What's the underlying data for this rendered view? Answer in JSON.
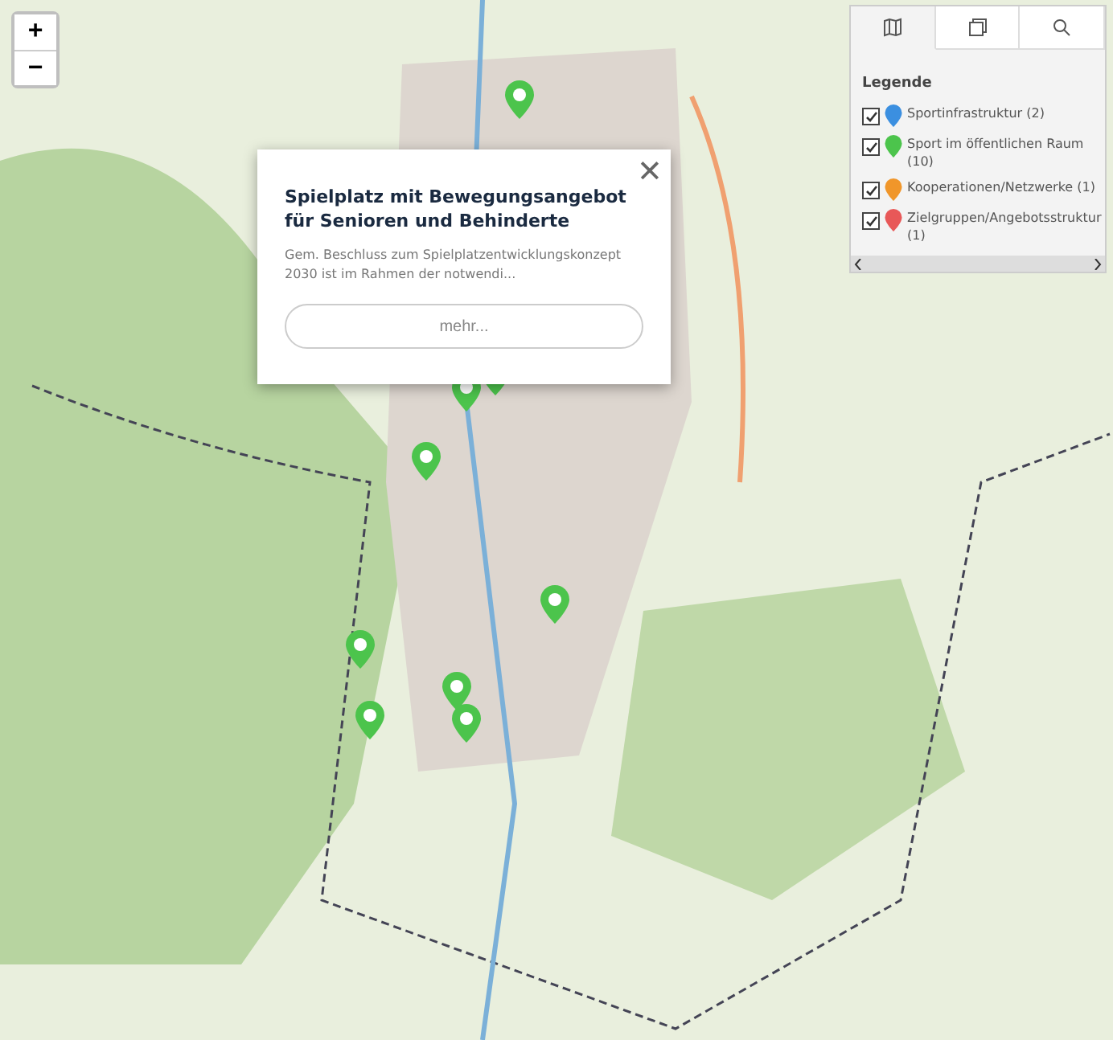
{
  "zoom_controls": {
    "zoom_in": "+",
    "zoom_out": "−"
  },
  "popup": {
    "close": "✕",
    "title": "Spielplatz mit Bewegungsangebot für Senioren und Behinderte",
    "description": "Gem. Beschluss zum Spielplatzentwicklungskonzept 2030 ist im Rahmen der notwendi...",
    "button": "mehr..."
  },
  "panel": {
    "tabs": [
      {
        "kind": "map",
        "selected": true
      },
      {
        "kind": "layers",
        "selected": false
      },
      {
        "kind": "search",
        "selected": false
      }
    ],
    "legend_title": "Legende",
    "items": [
      {
        "label": "Sportinfrastruktur (2)",
        "checked": true,
        "color": "#3b8fe0"
      },
      {
        "label": "Sport im öffentlichen Raum (10)",
        "checked": true,
        "color": "#4cc44c"
      },
      {
        "label": "Kooperationen/Netzwerke (1)",
        "checked": true,
        "color": "#f0962a"
      },
      {
        "label": "Zielgruppen/Angebotsstruktur (1)",
        "checked": true,
        "color": "#e85858"
      }
    ]
  }
}
